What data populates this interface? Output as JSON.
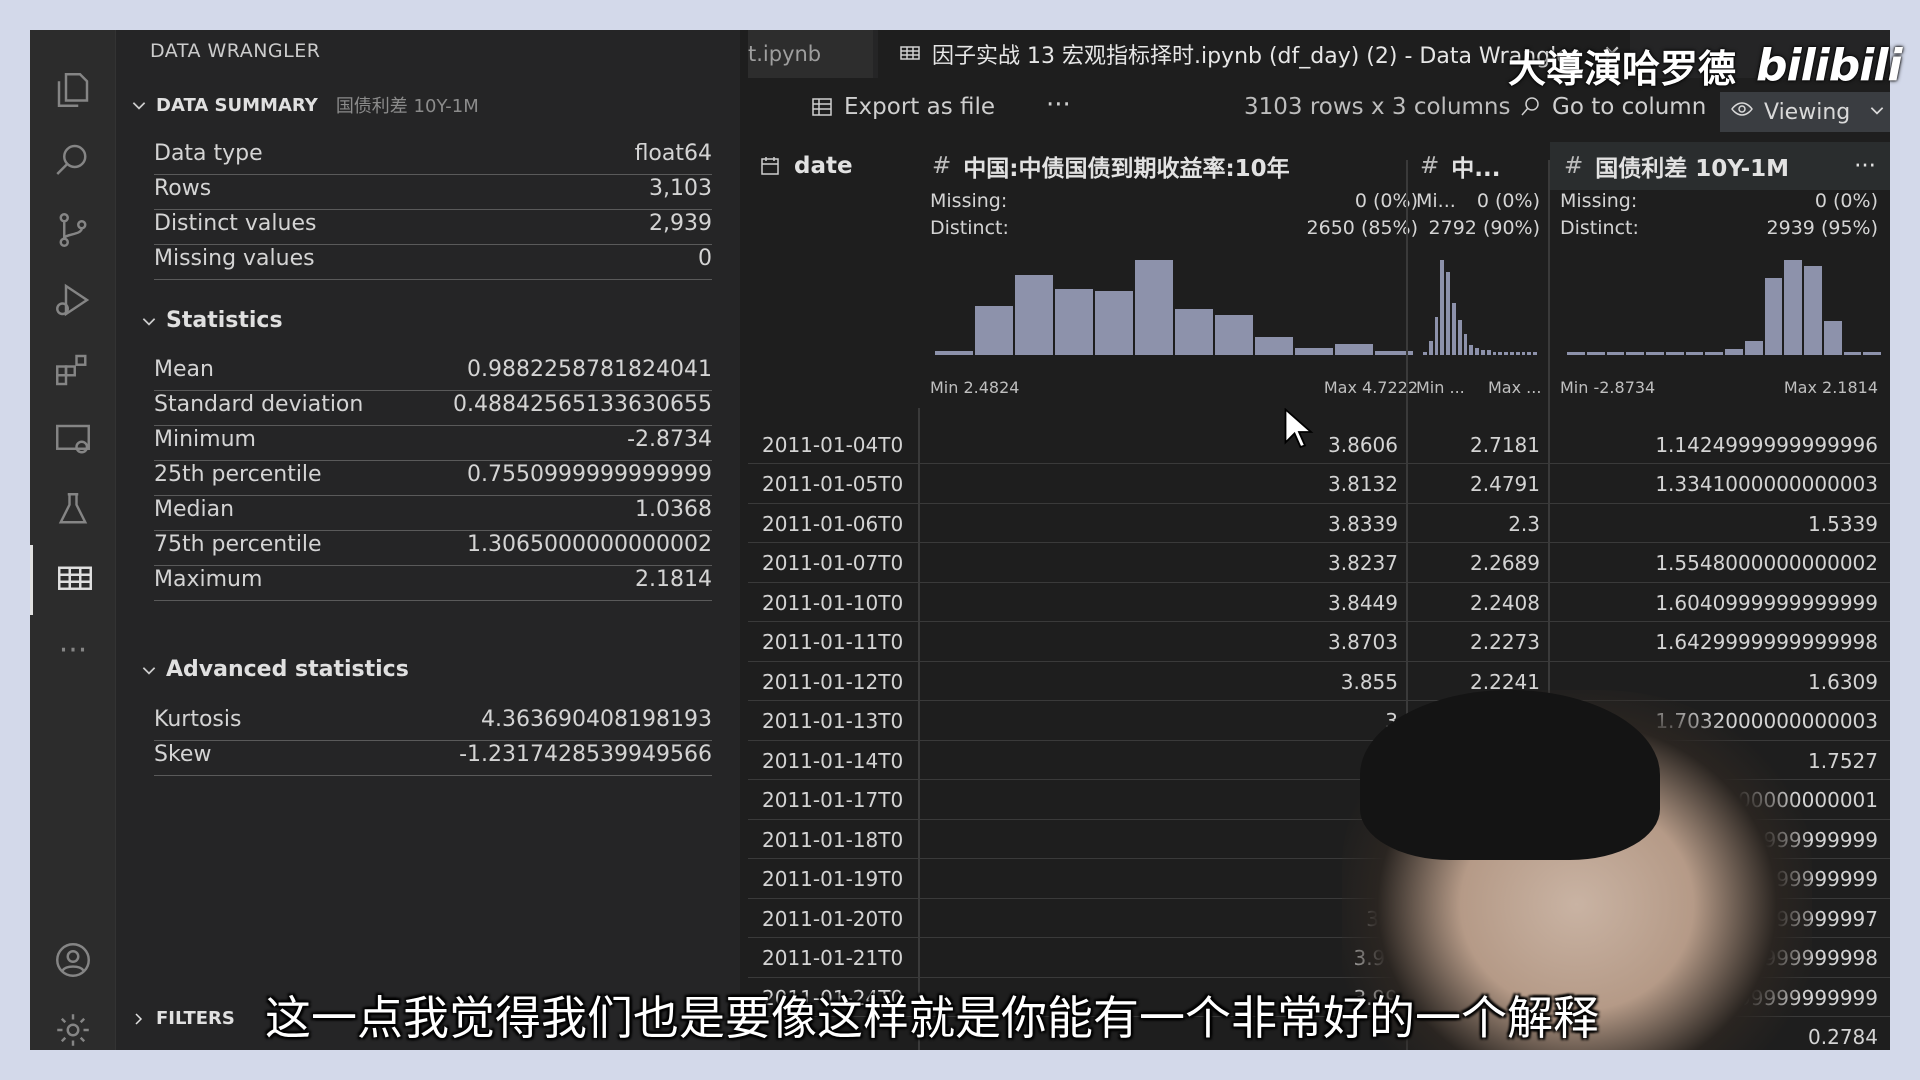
{
  "sidebar": {
    "title": "DATA WRANGLER",
    "summary_label": "DATA SUMMARY",
    "column_name": "国债利差 10Y-1M",
    "rows": [
      {
        "k": "Data type",
        "v": "float64"
      },
      {
        "k": "Rows",
        "v": "3,103"
      },
      {
        "k": "Distinct values",
        "v": "2,939"
      },
      {
        "k": "Missing values",
        "v": "0"
      }
    ],
    "statistics_label": "Statistics",
    "statistics": [
      {
        "k": "Mean",
        "v": "0.9882258781824041"
      },
      {
        "k": "Standard deviation",
        "v": "0.48842565133630655"
      },
      {
        "k": "Minimum",
        "v": "-2.8734"
      },
      {
        "k": "25th percentile",
        "v": "0.7550999999999999"
      },
      {
        "k": "Median",
        "v": "1.0368"
      },
      {
        "k": "75th percentile",
        "v": "1.3065000000000002"
      },
      {
        "k": "Maximum",
        "v": "2.1814"
      }
    ],
    "advanced_label": "Advanced statistics",
    "advanced": [
      {
        "k": "Kurtosis",
        "v": "4.363690408198193"
      },
      {
        "k": "Skew",
        "v": "-1.2317428539949566"
      }
    ],
    "filters_label": "FILTERS"
  },
  "tabs": {
    "prev": "t.ipynb",
    "active": "因子实战 13 宏观指标择时.ipynb (df_day) (2) - Data Wrangler"
  },
  "toolbar": {
    "export": "Export as file",
    "more": "···",
    "shape": "3103 rows x 3 columns",
    "goto": "Go to column",
    "viewing": "Viewing"
  },
  "columns": {
    "date": "date",
    "c1": {
      "name": "中国:中债国债到期收益率:10年",
      "missing_label": "Missing:",
      "missing": "0 (0%)",
      "distinct_label": "Distinct:",
      "distinct": "2650 (85%)",
      "min": "Min 2.4824",
      "max": "Max 4.7222"
    },
    "c2": {
      "name": "中...",
      "missing_label": "Mi...",
      "missing": "0 (0%)",
      "distinct": "2792 (90%)",
      "min": "Min ...",
      "max": "Max ..."
    },
    "c3": {
      "name": "国债利差 10Y-1M",
      "missing_label": "Missing:",
      "missing": "0 (0%)",
      "distinct_label": "Distinct:",
      "distinct": "2939 (95%)",
      "min": "Min -2.8734",
      "max": "Max 2.1814",
      "menu": "···"
    }
  },
  "rows": [
    {
      "date": "2011-01-04T0",
      "c1": "3.8606",
      "c2": "2.7181",
      "c3": "1.1424999999999996"
    },
    {
      "date": "2011-01-05T0",
      "c1": "3.8132",
      "c2": "2.4791",
      "c3": "1.3341000000000003"
    },
    {
      "date": "2011-01-06T0",
      "c1": "3.8339",
      "c2": "2.3",
      "c3": "1.5339"
    },
    {
      "date": "2011-01-07T0",
      "c1": "3.8237",
      "c2": "2.2689",
      "c3": "1.5548000000000002"
    },
    {
      "date": "2011-01-10T0",
      "c1": "3.8449",
      "c2": "2.2408",
      "c3": "1.6040999999999999"
    },
    {
      "date": "2011-01-11T0",
      "c1": "3.8703",
      "c2": "2.2273",
      "c3": "1.6429999999999998"
    },
    {
      "date": "2011-01-12T0",
      "c1": "3.855",
      "c2": "2.2241",
      "c3": "1.6309"
    },
    {
      "date": "2011-01-13T0",
      "c1": "3",
      "c2": "",
      "c3": "1.7032000000000003"
    },
    {
      "date": "2011-01-14T0",
      "c1": "3",
      "c2": "",
      "c3": "1.7527"
    },
    {
      "date": "2011-01-17T0",
      "c1": "3",
      "c2": "",
      "c3": "1.7549000000000001"
    },
    {
      "date": "2011-01-18T0",
      "c1": "3",
      "c2": "",
      "c3": "1.7570999999999999"
    },
    {
      "date": "2011-01-19T0",
      "c1": "3.",
      "c2": "",
      "c3": "1.3117999999999999"
    },
    {
      "date": "2011-01-20T0",
      "c1": "3.9",
      "c2": "",
      "c3": "0.9261999999999997"
    },
    {
      "date": "2011-01-21T0",
      "c1": "3.98",
      "c2": "",
      "c3": "0.8104999999999998"
    },
    {
      "date": "2011-01-24T0",
      "c1": "3.99",
      "c2": "",
      "c3": "...7999999999999"
    },
    {
      "date": "",
      "c1": "",
      "c2": "",
      "c3": "0.2784"
    }
  ],
  "hist1": [
    2,
    27,
    44,
    36,
    35,
    52,
    25,
    22,
    10,
    4,
    6,
    2
  ],
  "hist2": [
    2,
    8,
    22,
    55,
    48,
    30,
    20,
    12,
    6,
    4,
    3,
    3,
    2,
    2,
    2,
    2,
    2,
    2,
    2,
    2
  ],
  "hist3": [
    2,
    2,
    2,
    2,
    2,
    2,
    2,
    2,
    4,
    10,
    55,
    68,
    64,
    24,
    2,
    2
  ],
  "overlay": {
    "watermark": "大導演哈罗德",
    "logo": "bilibili",
    "subtitle": "这一点我觉得我们也是要像这样就是你能有一个非常好的一个解释"
  },
  "colors": {
    "hist": "#8d92ab",
    "bg": "#1e1e1e",
    "sidebar": "#252526"
  }
}
